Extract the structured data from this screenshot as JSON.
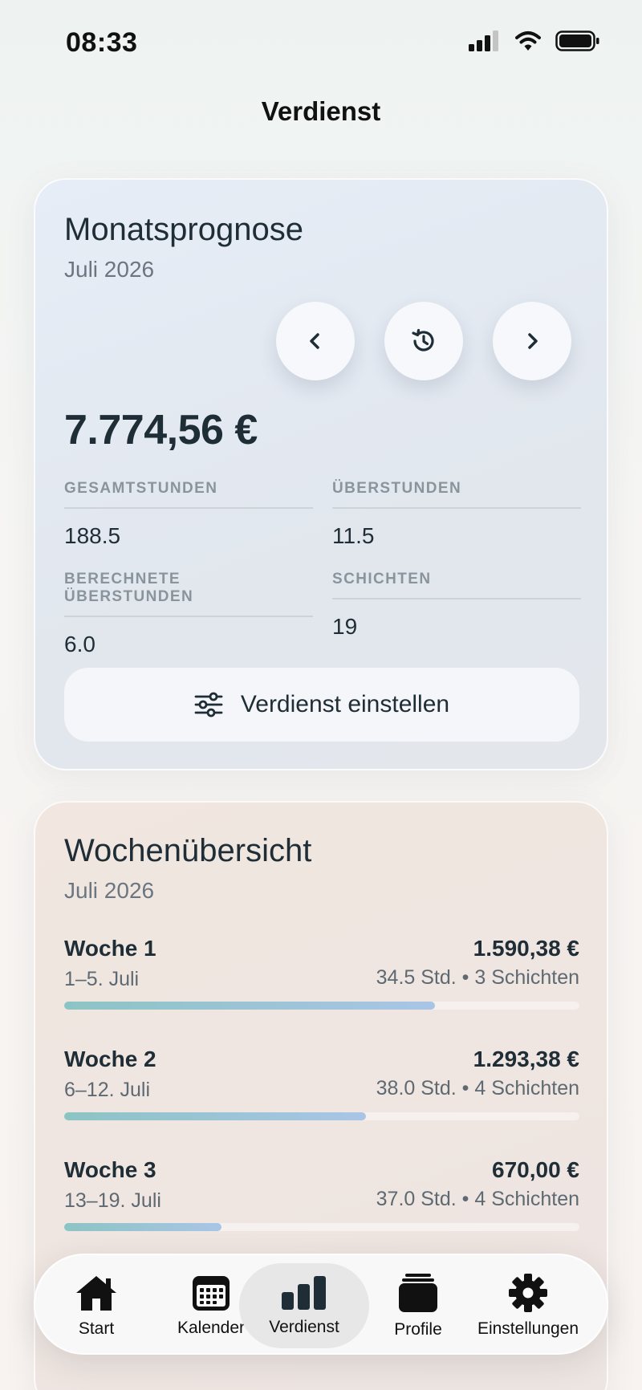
{
  "status": {
    "time": "08:33"
  },
  "page": {
    "title": "Verdienst"
  },
  "forecast": {
    "title": "Monatsprognose",
    "month": "Juli 2026",
    "amount": "7.774,56 €",
    "stats": [
      {
        "label": "GESAMTSTUNDEN",
        "value": "188.5"
      },
      {
        "label": "ÜBERSTUNDEN",
        "value": "11.5"
      },
      {
        "label": "BERECHNETE ÜBERSTUNDEN",
        "value": "6.0"
      },
      {
        "label": "SCHICHTEN",
        "value": "19"
      }
    ],
    "settings_button": "Verdienst einstellen"
  },
  "weeks": {
    "title": "Wochenübersicht",
    "month": "Juli 2026",
    "items": [
      {
        "name": "Woche 1",
        "range": "1–5. Juli",
        "amount": "1.590,38 €",
        "meta": "34.5 Std. • 3 Schichten",
        "progress": 0.72
      },
      {
        "name": "Woche 2",
        "range": "6–12. Juli",
        "amount": "1.293,38 €",
        "meta": "38.0 Std. • 4 Schichten",
        "progress": 0.585
      },
      {
        "name": "Woche 3",
        "range": "13–19. Juli",
        "amount": "670,00 €",
        "meta": "37.0 Std. • 4 Schichten",
        "progress": 0.305
      }
    ]
  },
  "tabs": [
    {
      "label": "Start",
      "icon": "house-icon"
    },
    {
      "label": "Kalender",
      "icon": "calendar-icon"
    },
    {
      "label": "Verdienst",
      "icon": "bar-chart-icon",
      "active": true
    },
    {
      "label": "Profile",
      "icon": "stack-icon"
    },
    {
      "label": "Einstellungen",
      "icon": "gear-icon"
    }
  ]
}
